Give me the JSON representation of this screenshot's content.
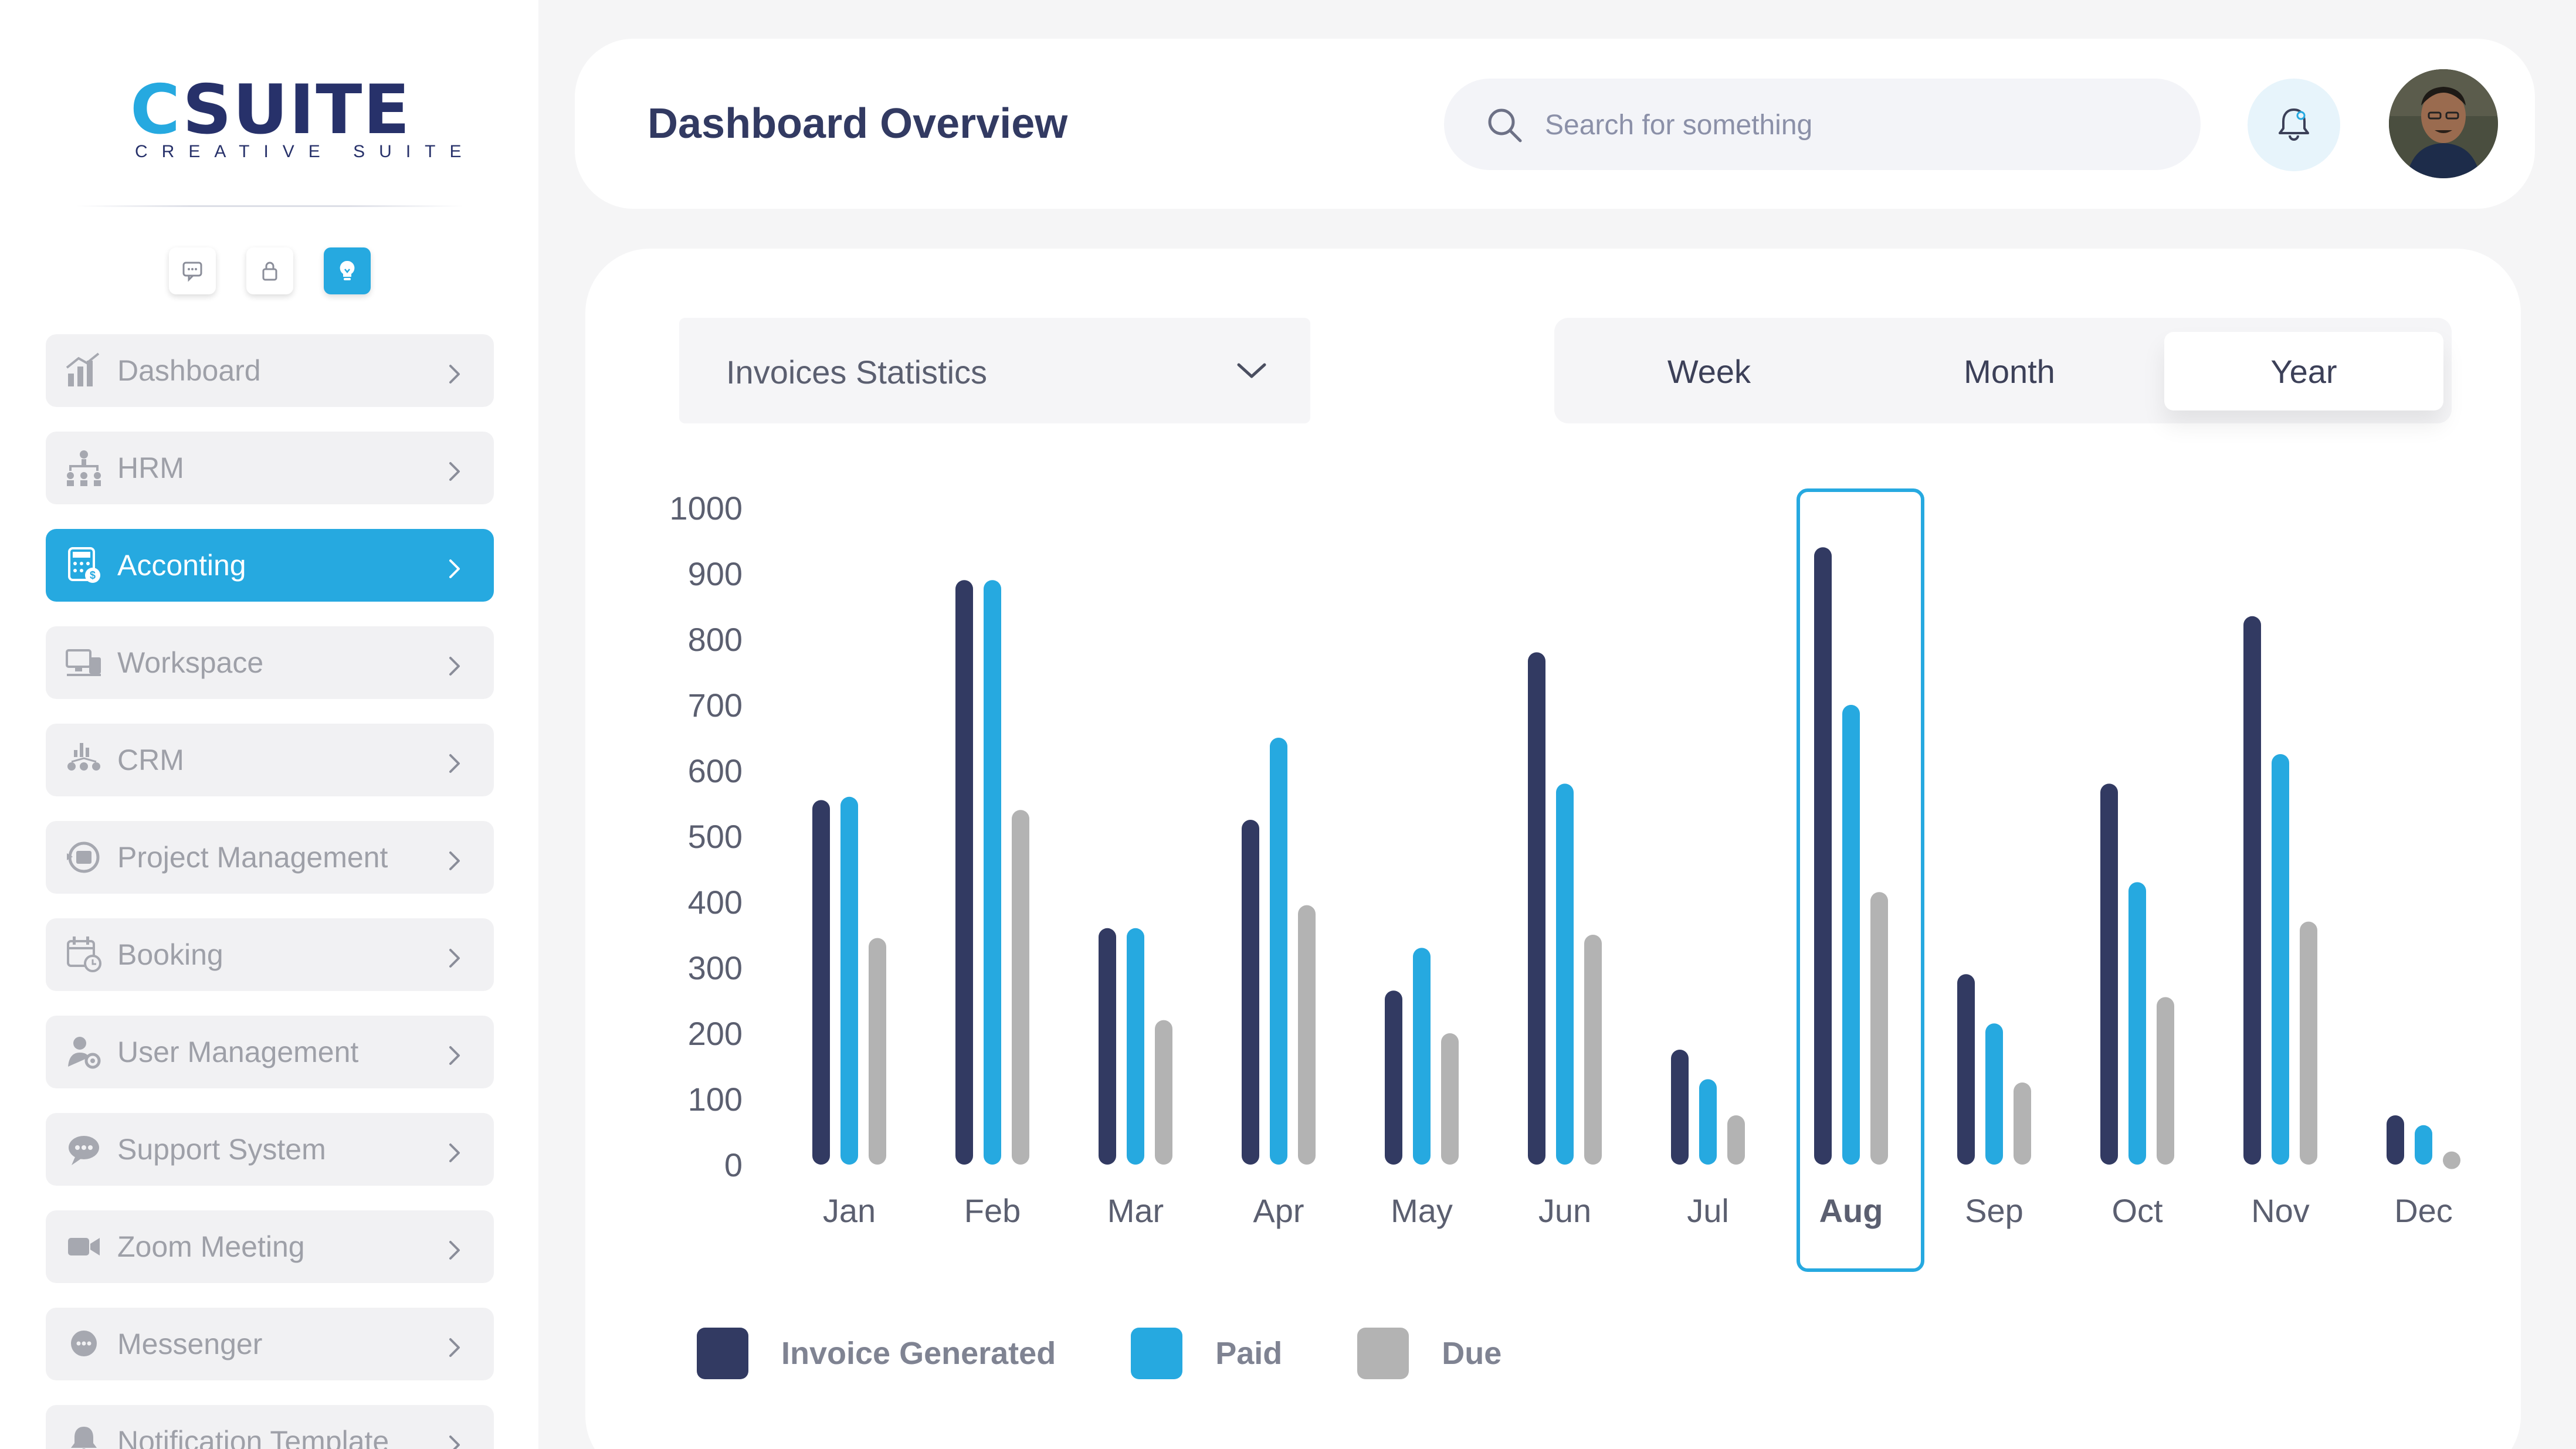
{
  "sidebar": {
    "logo": {
      "main": "CSUITE",
      "sub": "CREATIVE SUITE"
    },
    "quick_icons": [
      "chat-icon",
      "lock-icon",
      "lightbulb-icon"
    ],
    "items": [
      {
        "label": "Dashboard",
        "icon": "bar-chart-icon",
        "active": false
      },
      {
        "label": "HRM",
        "icon": "org-chart-icon",
        "active": false
      },
      {
        "label": "Acconting",
        "icon": "calculator-icon",
        "active": true
      },
      {
        "label": "Workspace",
        "icon": "desk-icon",
        "active": false
      },
      {
        "label": "CRM",
        "icon": "crm-icon",
        "active": false
      },
      {
        "label": "Project Management",
        "icon": "project-icon",
        "active": false
      },
      {
        "label": "Booking",
        "icon": "calendar-icon",
        "active": false
      },
      {
        "label": "User Management",
        "icon": "user-gear-icon",
        "active": false
      },
      {
        "label": "Support System",
        "icon": "support-chat-icon",
        "active": false
      },
      {
        "label": "Zoom Meeting",
        "icon": "video-camera-icon",
        "active": false
      },
      {
        "label": "Messenger",
        "icon": "message-bubble-icon",
        "active": false
      },
      {
        "label": "Notification Template",
        "icon": "bell-icon",
        "active": false
      }
    ]
  },
  "header": {
    "title": "Dashboard Overview",
    "search_placeholder": "Search for something"
  },
  "card": {
    "select_label": "Invoices Statistics",
    "periods": [
      "Week",
      "Month",
      "Year"
    ],
    "selected_period": "Year"
  },
  "colors": {
    "invoice_generated": "#323a62",
    "paid": "#26a9e0",
    "due": "#b3b3b3",
    "accent": "#26a9e0"
  },
  "chart_data": {
    "type": "bar",
    "categories": [
      "Jan",
      "Feb",
      "Mar",
      "Apr",
      "May",
      "Jun",
      "Jul",
      "Aug",
      "Sep",
      "Oct",
      "Nov",
      "Dec"
    ],
    "highlighted_category": "Aug",
    "yticks": [
      0,
      100,
      200,
      300,
      400,
      500,
      600,
      700,
      800,
      900,
      1000
    ],
    "ylim": [
      0,
      1000
    ],
    "series": [
      {
        "name": "Invoice Generated",
        "values": [
          555,
          890,
          360,
          525,
          265,
          780,
          175,
          940,
          290,
          580,
          835,
          75
        ]
      },
      {
        "name": "Paid",
        "values": [
          560,
          890,
          360,
          650,
          330,
          580,
          130,
          700,
          215,
          430,
          625,
          60
        ]
      },
      {
        "name": "Due",
        "values": [
          345,
          540,
          220,
          395,
          200,
          350,
          75,
          415,
          125,
          255,
          370,
          20
        ]
      }
    ],
    "legend_position": "bottom-left"
  }
}
